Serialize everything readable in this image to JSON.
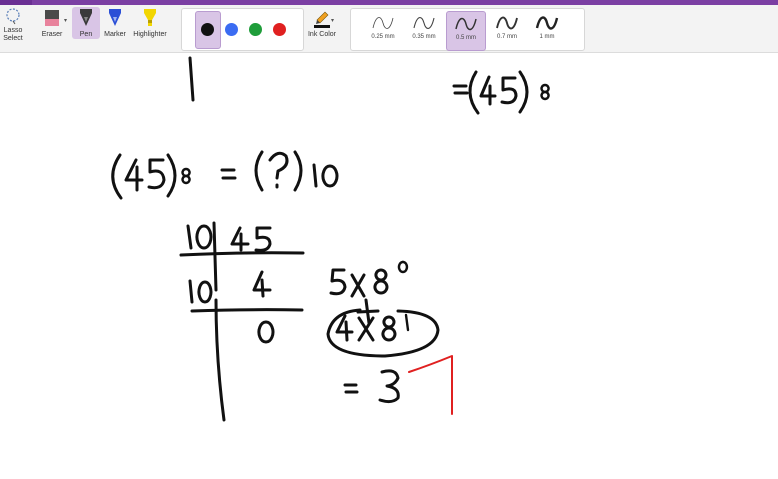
{
  "toolbar": {
    "lasso_label": "Lasso\nSelect",
    "eraser_label": "Eraser",
    "pen_label": "Pen",
    "marker_label": "Marker",
    "highlighter_label": "Highlighter",
    "ink_color_label": "Ink Color",
    "colors": [
      "#111111",
      "#3b6cf2",
      "#1f9d3a",
      "#e02020"
    ],
    "selected_color": "#111111",
    "thicknesses": [
      "0.25 mm",
      "0.35 mm",
      "0.5 mm",
      "0.7 mm",
      "1 mm"
    ],
    "selected_thickness": "0.5 mm",
    "accent": "#7b3fa3"
  },
  "canvas": {
    "ink_color": "#111111",
    "annotation_color": "#e02020"
  }
}
